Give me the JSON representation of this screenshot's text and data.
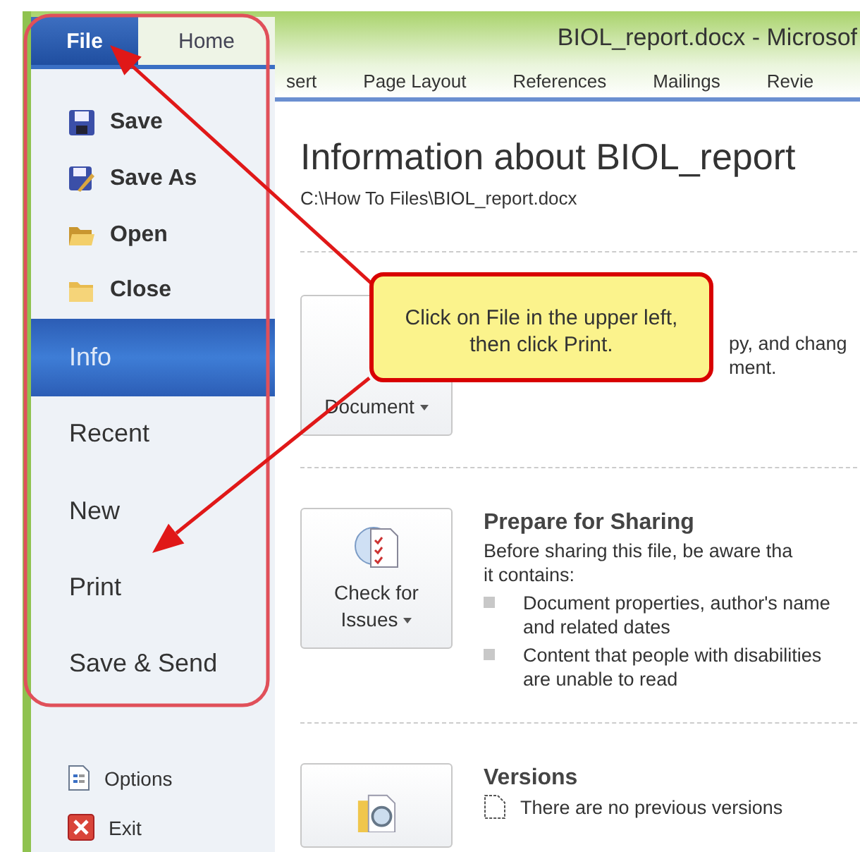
{
  "window": {
    "title": "BIOL_report.docx  -  Microsof"
  },
  "tabs": [
    {
      "label": "File",
      "selected": true
    },
    {
      "label": "Home",
      "selected": false
    }
  ],
  "ribbon_tabs": [
    "sert",
    "Page Layout",
    "References",
    "Mailings",
    "Revie"
  ],
  "backstage_menu": [
    {
      "label": "Save",
      "kind": "command",
      "selected": false
    },
    {
      "label": "Save As",
      "kind": "command",
      "selected": false
    },
    {
      "label": "Open",
      "kind": "command",
      "selected": false
    },
    {
      "label": "Close",
      "kind": "command",
      "selected": false
    },
    {
      "label": "Info",
      "kind": "page",
      "selected": true
    },
    {
      "label": "Recent",
      "kind": "page",
      "selected": false
    },
    {
      "label": "New",
      "kind": "page",
      "selected": false
    },
    {
      "label": "Print",
      "kind": "page",
      "selected": false
    },
    {
      "label": "Save & Send",
      "kind": "page",
      "selected": false
    },
    {
      "label": "Options",
      "kind": "command",
      "selected": false
    },
    {
      "label": "Exit",
      "kind": "command",
      "selected": false
    }
  ],
  "info": {
    "heading": "Information about BIOL_report",
    "path": "C:\\How To Files\\BIOL_report.docx",
    "sections": [
      {
        "button": "Document",
        "lines": [
          "py, and chang",
          "ment."
        ]
      },
      {
        "button": "Check for Issues",
        "title": "Prepare for Sharing",
        "lines": [
          "Before sharing this file, be aware tha",
          "it contains:"
        ],
        "bullets": [
          "Document properties, author's name and related dates",
          "Content that people with disabilities are unable to read"
        ]
      },
      {
        "title": "Versions",
        "lines": [
          "There are no previous versions"
        ]
      }
    ]
  },
  "callout": {
    "text": "Click on File in the upper left, then click Print."
  }
}
